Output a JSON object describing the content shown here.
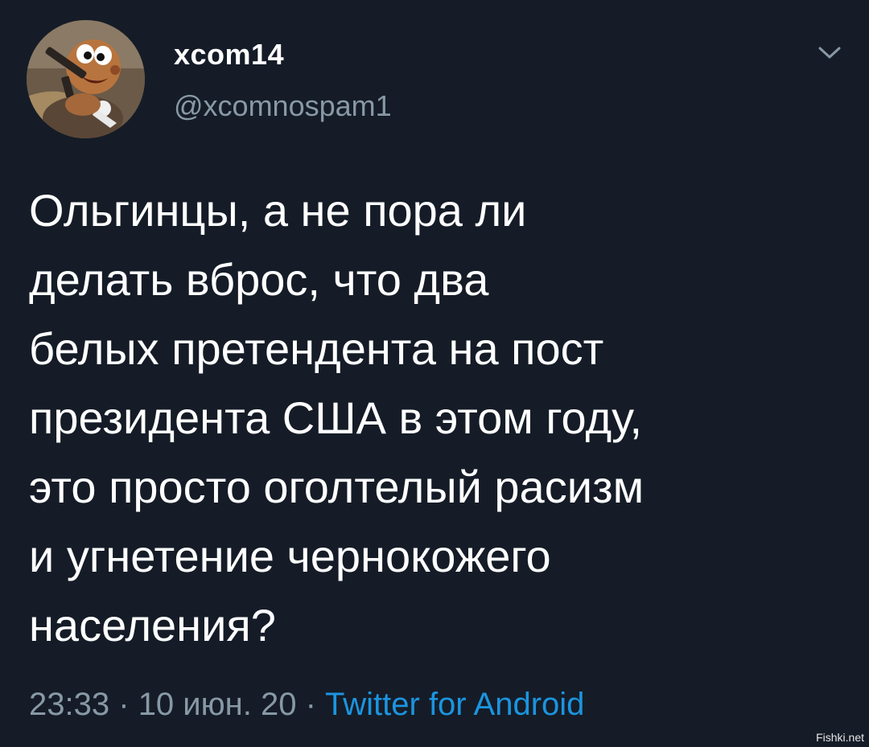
{
  "tweet": {
    "author": {
      "display_name": "xcom14",
      "handle": "@xcomnospam1",
      "avatar_icon": "cartoon-character-avatar"
    },
    "menu_icon": "chevron-down-icon",
    "text": "Ольгинцы, а не пора ли\nделать вброс, что два\nбелых претендента на пост\nпрезидента США в этом году,\nэто просто оголтелый расизм\nи угнетение чернокожего\nнаселения?",
    "time": "23:33",
    "date": "10 июн. 20",
    "separator": "·",
    "source": "Twitter for Android"
  },
  "watermark": "Fishki.net",
  "colors": {
    "background": "#151c27",
    "primary_text": "#ffffff",
    "secondary_text": "#8899a6",
    "link": "#1b95e0"
  }
}
